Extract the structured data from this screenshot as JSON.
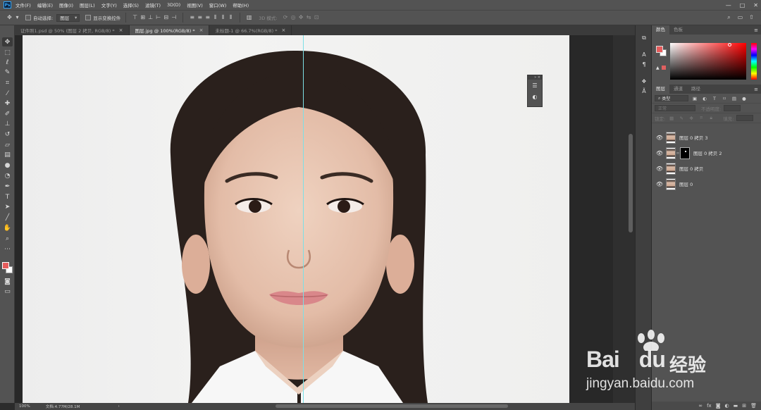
{
  "app": {
    "logo": "Ps",
    "menu": [
      "文件(F)",
      "编辑(E)",
      "图像(I)",
      "图层(L)",
      "文字(Y)",
      "选择(S)",
      "滤镜(T)",
      "3D(D)",
      "视图(V)",
      "窗口(W)",
      "帮助(H)"
    ],
    "window_controls": [
      "—",
      "□",
      "✕"
    ]
  },
  "options_bar": {
    "auto_select_label": "自动选择:",
    "auto_select_value": "图层",
    "transform_label": "显示变换控件",
    "mode_3d_label": "3D 模式:"
  },
  "tabs": [
    {
      "label": "证件照1.psd @ 50% (图层 2 拷贝, RGB/8) *",
      "active": false
    },
    {
      "label": "图层.jpg @ 100%(RGB/8) *",
      "active": true
    },
    {
      "label": "未标题-1 @ 66.7%(RGB/8) *",
      "active": false
    }
  ],
  "tools": [
    "move-tool-icon",
    "marquee-tool-icon",
    "lasso-tool-icon",
    "quick-select-tool-icon",
    "crop-tool-icon",
    "eyedropper-tool-icon",
    "healing-brush-tool-icon",
    "brush-tool-icon",
    "clone-stamp-tool-icon",
    "history-brush-tool-icon",
    "eraser-tool-icon",
    "gradient-tool-icon",
    "blur-tool-icon",
    "dodge-tool-icon",
    "pen-tool-icon",
    "type-tool-icon",
    "path-select-tool-icon",
    "line-tool-icon",
    "hand-tool-icon",
    "zoom-tool-icon"
  ],
  "colors": {
    "foreground": "#e65c5c",
    "background": "#ffffff"
  },
  "status": {
    "zoom": "100%",
    "doc": "文档:4.77M/28.1M"
  },
  "panels": {
    "color_tabs": [
      "颜色",
      "色板"
    ],
    "layers_tabs": [
      "图层",
      "通道",
      "路径"
    ],
    "kind_label": "类型",
    "blend_mode": "正常",
    "opacity_label": "不透明度:",
    "lock_label": "锁定:",
    "fill_label": "填充:"
  },
  "layers": [
    {
      "name": "图层 0 拷贝 3",
      "mask": false
    },
    {
      "name": "图层 0 拷贝 2",
      "mask": true
    },
    {
      "name": "图层 0 拷贝",
      "mask": false
    },
    {
      "name": "图层 0",
      "mask": false
    }
  ],
  "watermark": {
    "brand": "Bai",
    "brand2": "du",
    "jingyan": "经验",
    "url": "jingyan.baidu.com"
  }
}
